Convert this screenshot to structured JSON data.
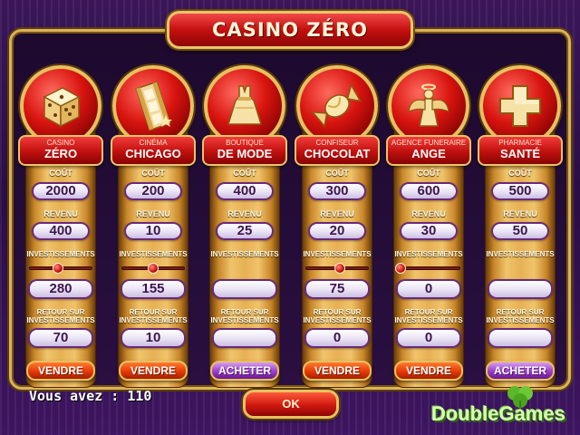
{
  "title": "CASINO ZÉRO",
  "labels": {
    "cost": "COÛT",
    "revenue": "REVENU",
    "investments": "INVESTISSEMENTS",
    "return_line1": "RETOUR SUR",
    "return_line2": "INVESTISSEMENTS"
  },
  "businesses": [
    {
      "icon": "dice-icon",
      "name_top": "CASINO",
      "name_main": "ZÉRO",
      "cost": "2000",
      "revenue": "400",
      "investment_level": 0.45,
      "investments": "280",
      "return": "70",
      "action": "VENDRE",
      "action_type": "sell"
    },
    {
      "icon": "film-icon",
      "name_top": "Cinéma",
      "name_main": "CHICAGO",
      "cost": "200",
      "revenue": "10",
      "investment_level": 0.5,
      "investments": "155",
      "return": "10",
      "action": "VENDRE",
      "action_type": "sell"
    },
    {
      "icon": "dress-icon",
      "name_top": "BOUTIQUE",
      "name_main": "DE MODE",
      "cost": "400",
      "revenue": "25",
      "investment_level": null,
      "investments": "",
      "return": "",
      "action": "ACHETER",
      "action_type": "buy"
    },
    {
      "icon": "candy-icon",
      "name_top": "CONFISEUR",
      "name_main": "CHOCOLAT",
      "cost": "300",
      "revenue": "20",
      "investment_level": 0.55,
      "investments": "75",
      "return": "0",
      "action": "VENDRE",
      "action_type": "sell"
    },
    {
      "icon": "angel-icon",
      "name_top": "AGENCE FUNERAIRE",
      "name_main": "ANGE",
      "cost": "600",
      "revenue": "30",
      "investment_level": 0.05,
      "investments": "0",
      "return": "0",
      "action": "VENDRE",
      "action_type": "sell"
    },
    {
      "icon": "cross-icon",
      "name_top": "PHARMACIE",
      "name_main": "SANTÉ",
      "cost": "500",
      "revenue": "50",
      "investment_level": null,
      "investments": "",
      "return": "",
      "action": "ACHETER",
      "action_type": "buy"
    }
  ],
  "balance": "Vous avez : 110",
  "ok_label": "OK",
  "watermark": "DoubleGames",
  "colors": {
    "gold": "#e8c061",
    "red": "#c4100e",
    "sell_orange": "#e63a07",
    "buy_purple": "#9b3cc8",
    "pill_text": "#3b164d"
  }
}
